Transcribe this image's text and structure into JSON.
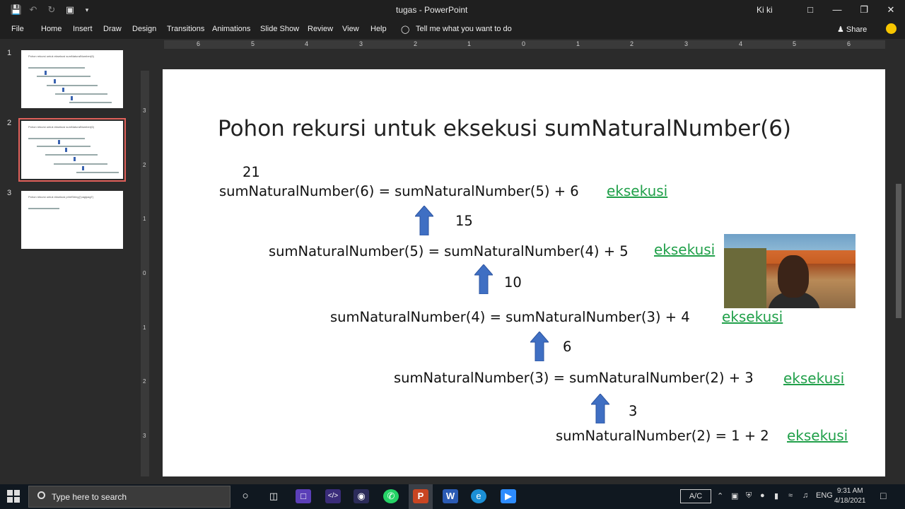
{
  "titlebar": {
    "document_title": "tugas - PowerPoint",
    "user_name": "Ki ki",
    "qa_icons": [
      "save-icon",
      "undo-icon",
      "redo-icon",
      "present-icon",
      "customize-icon"
    ],
    "controls": [
      "ribbon-display-icon",
      "minimize-icon",
      "restore-icon",
      "close-icon"
    ]
  },
  "menu": {
    "items": [
      "File",
      "Home",
      "Insert",
      "Draw",
      "Design",
      "Transitions",
      "Animations",
      "Slide Show",
      "Review",
      "View",
      "Help"
    ],
    "tell_me": "Tell me what you want to do",
    "share": "Share"
  },
  "ruler": {
    "h_ticks": [
      "6",
      "5",
      "4",
      "3",
      "2",
      "1",
      "0",
      "1",
      "2",
      "3",
      "4",
      "5",
      "6"
    ],
    "v_ticks": [
      "3",
      "2",
      "1",
      "0",
      "1",
      "2",
      "3"
    ]
  },
  "thumbnails": [
    {
      "num": "1",
      "title": "Pohon rekursi untuk eksekusi sumNaturalNumber(6)"
    },
    {
      "num": "2",
      "title": "Pohon rekursi untuk eksekusi sumNaturalNumber(6)"
    },
    {
      "num": "3",
      "title": "Pohon rekursi untuk eksekusi printString(\"pagipagi\")"
    }
  ],
  "slide": {
    "title": "Pohon rekursi untuk eksekusi sumNaturalNumber(6)",
    "rows": [
      {
        "result": "21",
        "equation": "sumNaturalNumber(6) = sumNaturalNumber(5) + 6",
        "label": "eksekusi"
      },
      {
        "result": "15",
        "equation": "sumNaturalNumber(5) = sumNaturalNumber(4) + 5",
        "label": "eksekusi"
      },
      {
        "result": "10",
        "equation": "sumNaturalNumber(4) = sumNaturalNumber(3) + 4",
        "label": "eksekusi"
      },
      {
        "result": "6",
        "equation": "sumNaturalNumber(3) = sumNaturalNumber(2) + 3",
        "label": "eksekusi"
      },
      {
        "result": "3",
        "equation": "sumNaturalNumber(2) = 1 + 2",
        "label": "eksekusi"
      }
    ],
    "accent_color": "#21a04a",
    "arrow_color": "#3f6fc3"
  },
  "taskbar": {
    "search_placeholder": "Type here to search",
    "apps": [
      "cortana-icon",
      "task-view-icon",
      "files-icon",
      "code-icon",
      "obs-icon",
      "whatsapp-icon",
      "powerpoint-icon",
      "word-icon",
      "edge-icon",
      "zoom-icon"
    ],
    "ac_label": "A/C",
    "lang": "ENG",
    "time": "9:31 AM",
    "date": "4/18/2021"
  }
}
